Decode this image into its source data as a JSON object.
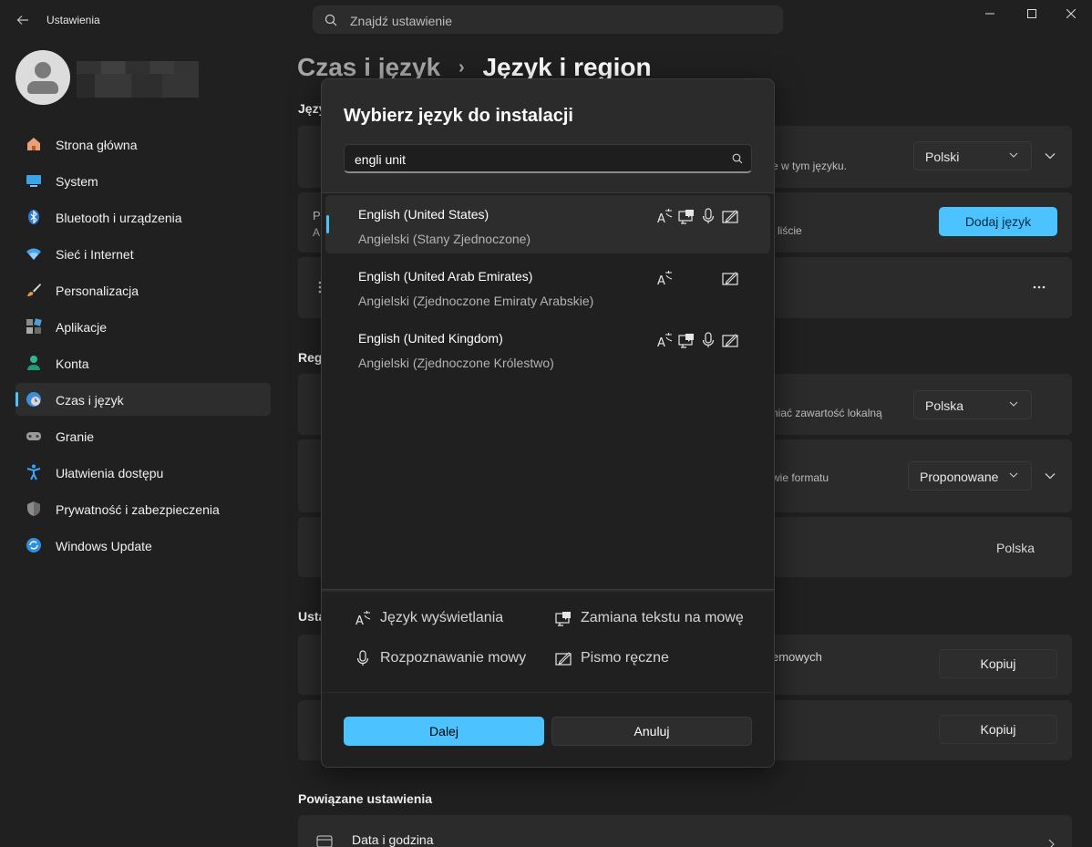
{
  "app": {
    "title": "Ustawienia",
    "search_placeholder": "Znajdź ustawienie"
  },
  "window_controls": [
    "minimize",
    "maximize",
    "close"
  ],
  "breadcrumb": {
    "parent": "Czas i język",
    "separator": "›",
    "current": "Język i region"
  },
  "sidebar": {
    "items": [
      {
        "label": "Strona główna",
        "icon": "home-icon"
      },
      {
        "label": "System",
        "icon": "system-icon"
      },
      {
        "label": "Bluetooth i urządzenia",
        "icon": "bluetooth-icon"
      },
      {
        "label": "Sieć i Internet",
        "icon": "wifi-icon"
      },
      {
        "label": "Personalizacja",
        "icon": "brush-icon"
      },
      {
        "label": "Aplikacje",
        "icon": "apps-icon"
      },
      {
        "label": "Konta",
        "icon": "account-icon"
      },
      {
        "label": "Czas i język",
        "icon": "time-language-icon",
        "active": true
      },
      {
        "label": "Granie",
        "icon": "gaming-icon"
      },
      {
        "label": "Ułatwienia dostępu",
        "icon": "accessibility-icon"
      },
      {
        "label": "Prywatność i zabezpieczenia",
        "icon": "shield-icon"
      },
      {
        "label": "Windows Update",
        "icon": "update-icon"
      }
    ]
  },
  "background": {
    "section_language": "Języ",
    "display_lang_desc": "e w tym języku.",
    "display_lang_value": "Polski",
    "preferred_frag_title": "P",
    "preferred_frag_sub": "A",
    "preferred_desc": "j liście",
    "add_language": "Dodaj język",
    "section_region": "Regi",
    "country_desc": "niać zawartość lokalną",
    "country_value": "Polska",
    "format_desc": "wie formatu",
    "format_value": "Proponowane",
    "system_locale_value": "Polska",
    "section_admin": "Usta",
    "copy_desc": "emowych",
    "copy_1": "Kopiuj",
    "copy_2": "Kopiuj",
    "related_heading": "Powiązane ustawienia",
    "date_time": "Data i godzina"
  },
  "dialog": {
    "title": "Wybierz język do instalacji",
    "search_value": "engli unit",
    "languages": [
      {
        "name": "English (United States)",
        "native": "Angielski (Stany Zjednoczone)",
        "selected": true,
        "features": [
          "display",
          "tts",
          "speech",
          "handwriting"
        ]
      },
      {
        "name": "English (United Arab Emirates)",
        "native": "Angielski (Zjednoczone Emiraty Arabskie)",
        "selected": false,
        "features": [
          "display",
          "handwriting"
        ]
      },
      {
        "name": "English (United Kingdom)",
        "native": "Angielski (Zjednoczone Królestwo)",
        "selected": false,
        "features": [
          "display",
          "tts",
          "speech",
          "handwriting"
        ]
      }
    ],
    "legend": {
      "display": "Język wyświetlania",
      "tts": "Zamiana tekstu na mowę",
      "speech": "Rozpoznawanie mowy",
      "handwriting": "Pismo ręczne"
    },
    "next": "Dalej",
    "cancel": "Anuluj"
  },
  "colors": {
    "accent": "#4cc2ff",
    "background": "#202020",
    "card": "#2b2b2b"
  }
}
